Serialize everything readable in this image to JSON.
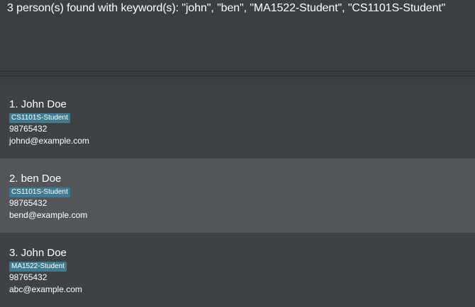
{
  "result_display": {
    "message": "3 person(s) found with keyword(s): \"john\", \"ben\", \"MA1522-Student\", \"CS1101S-Student\""
  },
  "person_list": [
    {
      "name": "1. John Doe",
      "tag": "CS1101S-Student",
      "phone": "98765432",
      "email": "johnd@example.com"
    },
    {
      "name": "2. ben Doe",
      "tag": "CS1101S-Student",
      "phone": "98765432",
      "email": "bend@example.com"
    },
    {
      "name": "3. John Doe",
      "tag": "MA1522-Student",
      "phone": "98765432",
      "email": "abc@example.com"
    }
  ],
  "colors": {
    "background": "#3c3f41",
    "card_odd": "#3e4245",
    "card_even": "#515658",
    "tag": "#3e7b91",
    "text": "#ffffff"
  }
}
